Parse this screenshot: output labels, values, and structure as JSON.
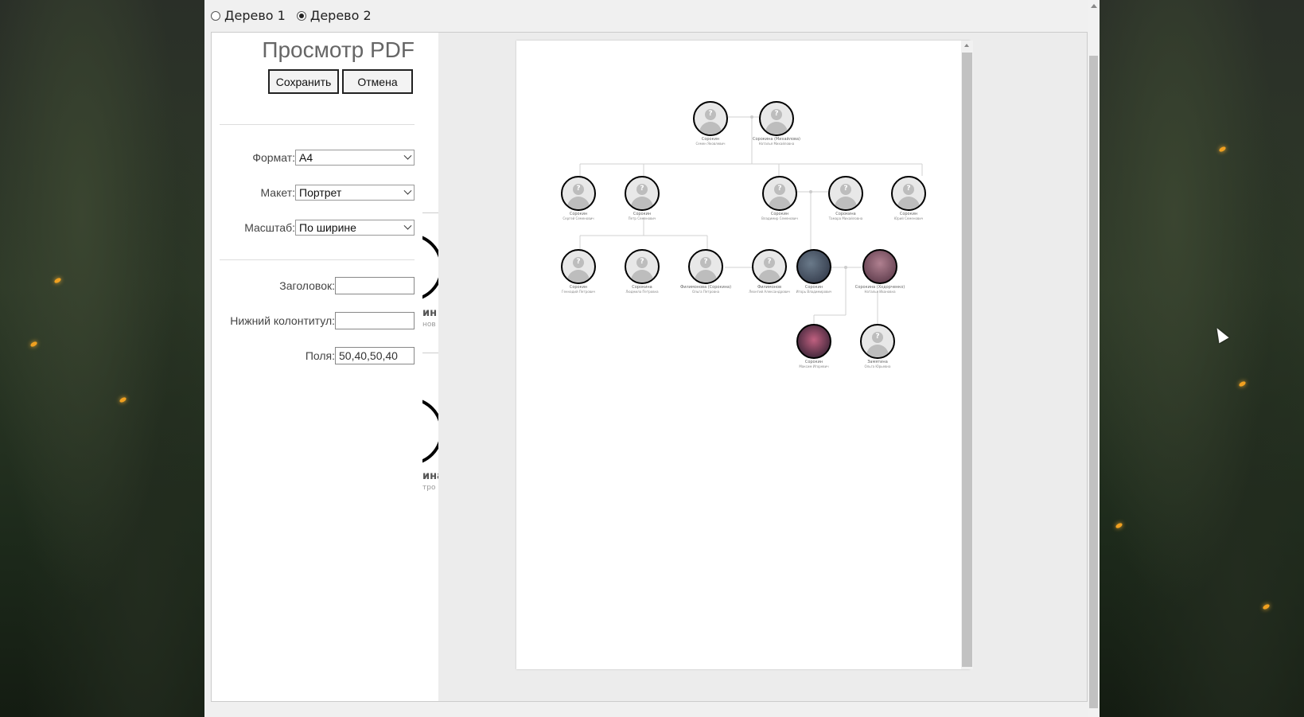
{
  "tree_selector": {
    "options": [
      {
        "label": "Дерево 1",
        "selected": false
      },
      {
        "label": "Дерево 2",
        "selected": true
      }
    ]
  },
  "settings": {
    "title": "Просмотр PDF",
    "save_label": "Сохранить",
    "cancel_label": "Отмена",
    "format_label": "Формат:",
    "format_value": "A4",
    "layout_label": "Макет:",
    "layout_value": "Портрет",
    "scale_label": "Масштаб:",
    "scale_value": "По ширине",
    "header_label": "Заголовок:",
    "header_value": "",
    "footer_label": "Нижний колонтитул:",
    "footer_value": "",
    "margins_label": "Поля:",
    "margins_value": "50,40,50,40"
  },
  "peek": {
    "name1": "ин",
    "sub1": "нов",
    "name2": "ина",
    "sub2": "тро"
  },
  "tree_nodes": [
    {
      "name": "Сорокин",
      "sub": "Семен Яковлевич",
      "gender": "m"
    },
    {
      "name": "Сорокина (Михайлова)",
      "sub": "Наталья Михайловна",
      "gender": "f"
    },
    {
      "name": "Сорокин",
      "sub": "Сергей Семенович",
      "gender": "m"
    },
    {
      "name": "Сорокин",
      "sub": "Петр Семенович",
      "gender": "m"
    },
    {
      "name": "Сорокин",
      "sub": "Владимир Семенович",
      "gender": "m"
    },
    {
      "name": "Сорокина",
      "sub": "Тамара Михайловна",
      "gender": "f"
    },
    {
      "name": "Сорокин",
      "sub": "Юрий Семенович",
      "gender": "m"
    },
    {
      "name": "Сорокин",
      "sub": "Геннадий Петрович",
      "gender": "m"
    },
    {
      "name": "Сорокина",
      "sub": "Людмила Петровна",
      "gender": "f"
    },
    {
      "name": "Филимонова (Сорокина)",
      "sub": "Ольга Петровна",
      "gender": "f"
    },
    {
      "name": "Филимонов",
      "sub": "Леонтий Александрович",
      "gender": "m"
    },
    {
      "name": "Сорокин",
      "sub": "Игорь Владимирович",
      "gender": "m"
    },
    {
      "name": "Сорокина (Ходорченко)",
      "sub": "Наталья Ивановна",
      "gender": "f"
    },
    {
      "name": "Сорокин",
      "sub": "Максим Игоревич",
      "gender": "m"
    },
    {
      "name": "Замятина",
      "sub": "Ольга Юрьевна",
      "gender": "m"
    }
  ]
}
